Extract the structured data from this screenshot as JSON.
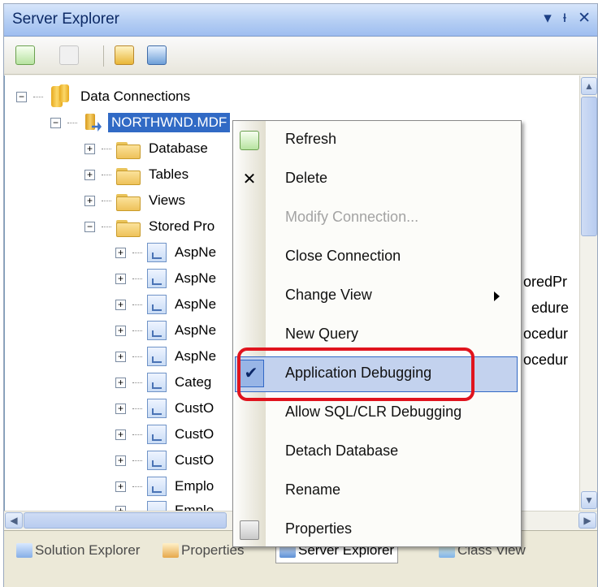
{
  "window": {
    "title": "Server Explorer",
    "dropdown_glyph": "▾",
    "pin_glyph": "ᵻ",
    "close_glyph": "✕"
  },
  "tree": {
    "root_label": "Data Connections",
    "connection_label": "NORTHWND.MDF",
    "folders": [
      "Database",
      "Tables",
      "Views",
      "Stored Pro"
    ],
    "procedures": [
      "AspNe",
      "AspNe",
      "AspNe",
      "AspNe",
      "AspNe",
      "Categ",
      "CustO",
      "CustO",
      "CustO",
      "Emplo",
      "Emplo"
    ],
    "right_peek": [
      "oredPr",
      "edure",
      "ocedur",
      "ocedur"
    ]
  },
  "context_menu": {
    "items": [
      {
        "label": "Refresh",
        "icon": "refresh-icon",
        "disabled": false
      },
      {
        "label": "Delete",
        "icon": "delete-x-icon",
        "disabled": false
      },
      {
        "label": "Modify Connection...",
        "disabled": true
      },
      {
        "label": "Close Connection",
        "disabled": false
      },
      {
        "label": "Change View",
        "submenu": true,
        "disabled": false
      },
      {
        "label": "New Query",
        "disabled": false
      },
      {
        "label": "Application Debugging",
        "checked": true,
        "disabled": false
      },
      {
        "label": "Allow SQL/CLR Debugging",
        "disabled": false
      },
      {
        "label": "Detach Database",
        "disabled": false
      },
      {
        "label": "Rename",
        "disabled": false
      },
      {
        "label": "Properties",
        "icon": "properties-icon",
        "disabled": false
      }
    ],
    "check_glyph": "✔",
    "delete_glyph": "✕"
  },
  "tabs": [
    "Solution Explorer",
    "Properties",
    "Server Explorer",
    "Class View"
  ],
  "colors": {
    "highlight": "#c3d2ee",
    "annotation_red": "#e0141e",
    "selection_blue": "#316ac5"
  }
}
